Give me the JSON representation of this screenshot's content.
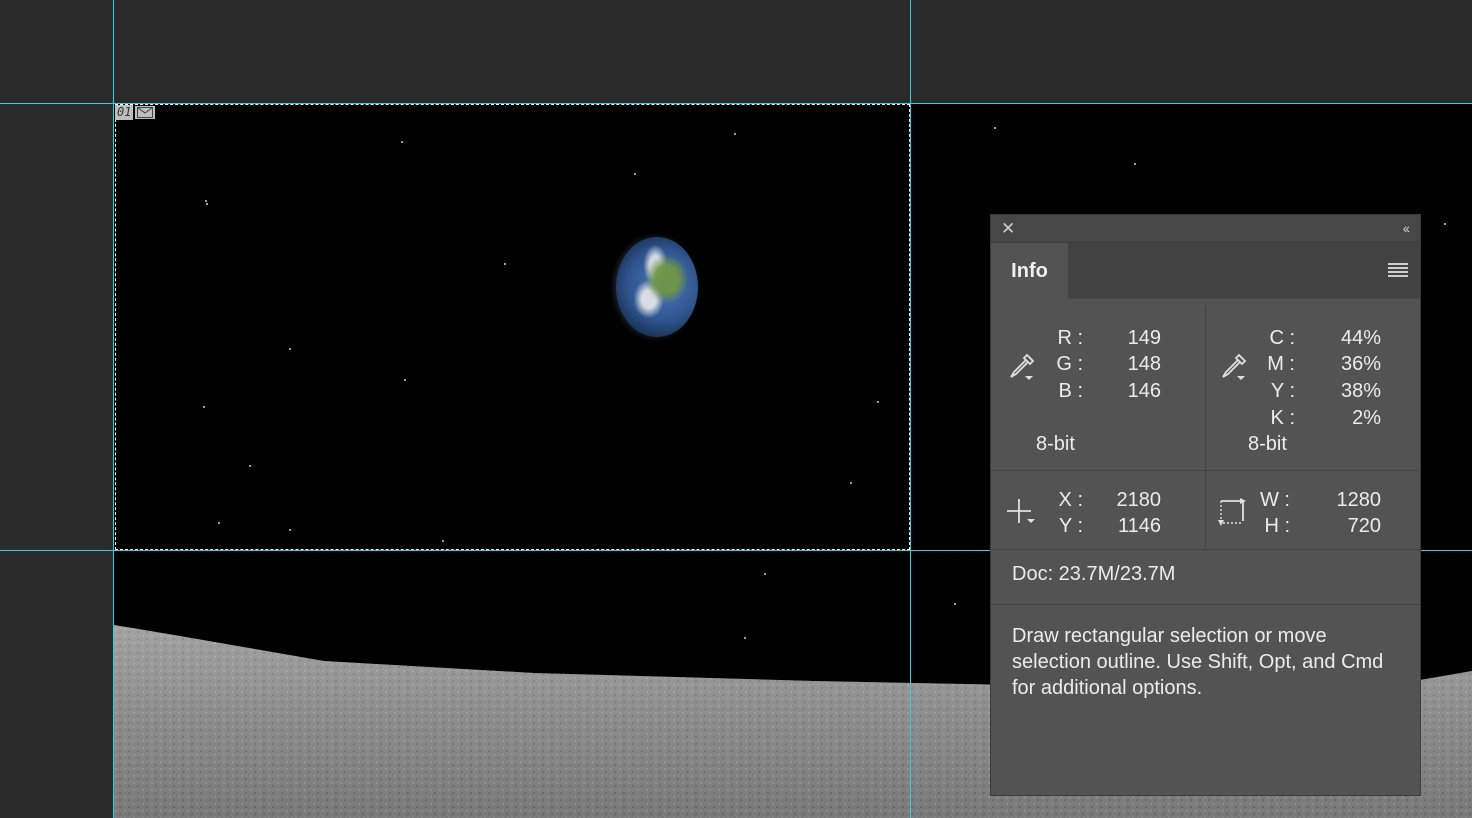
{
  "slice": {
    "number": "01"
  },
  "panel": {
    "tab_label": "Info",
    "rgb": {
      "labels": [
        "R :",
        "G :",
        "B :"
      ],
      "values": [
        "149",
        "148",
        "146"
      ],
      "bit_depth": "8-bit"
    },
    "cmyk": {
      "labels": [
        "C :",
        "M :",
        "Y :",
        "K :"
      ],
      "values": [
        "44%",
        "36%",
        "38%",
        "2%"
      ],
      "bit_depth": "8-bit"
    },
    "position": {
      "x_label": "X :",
      "x_value": "2180",
      "y_label": "Y :",
      "y_value": "1146"
    },
    "size": {
      "w_label": "W :",
      "w_value": "1280",
      "h_label": "H :",
      "h_value": "720"
    },
    "doc": "Doc: 23.7M/23.7M",
    "help": "Draw rectangular selection or move selection outline.  Use Shift, Opt, and Cmd for additional options."
  },
  "icons": [
    "eyedropper-icon",
    "crosshair-icon",
    "selection-size-icon",
    "close-icon",
    "collapse-icon",
    "panel-menu-icon",
    "slice-icon"
  ],
  "colors": {
    "guide": "#27d3e6",
    "panel_bg": "#535353",
    "app_bg": "#2b2b2b"
  }
}
